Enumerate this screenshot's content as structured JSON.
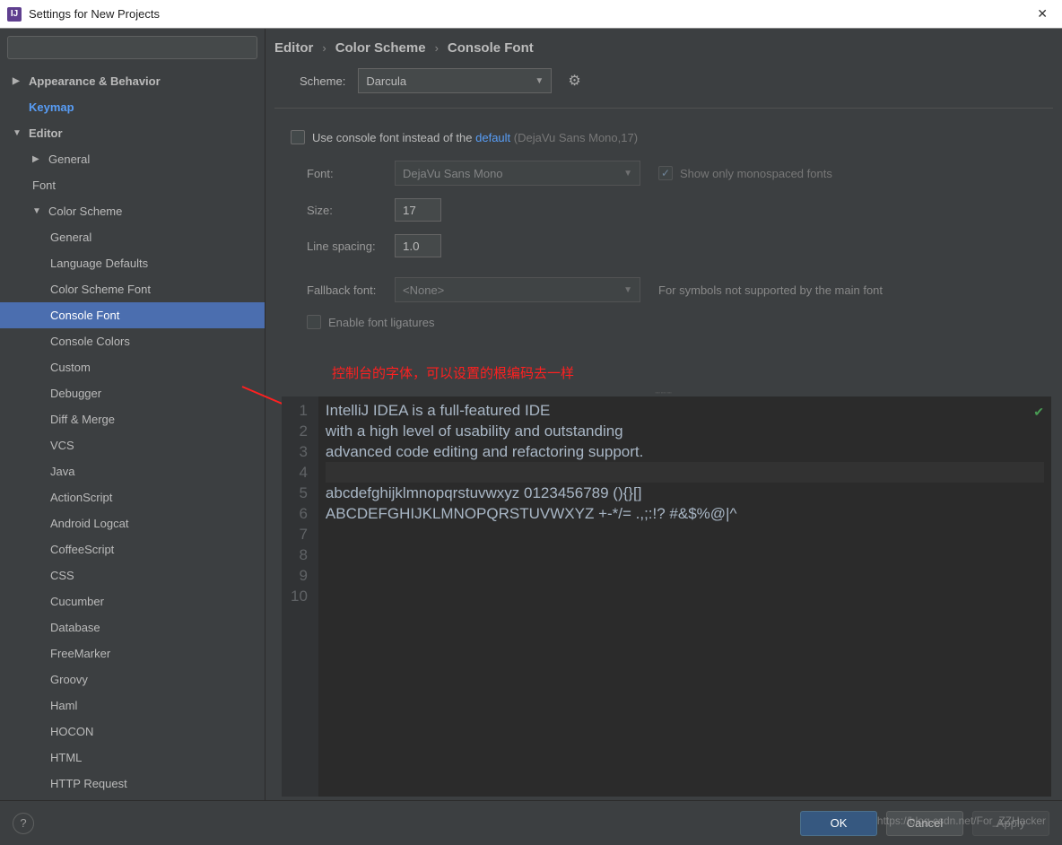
{
  "window": {
    "title": "Settings for New Projects"
  },
  "search": {
    "placeholder": ""
  },
  "tree": [
    {
      "label": "Appearance & Behavior",
      "level": 0,
      "bold": true,
      "arrow": "▶"
    },
    {
      "label": "Keymap",
      "level": 0,
      "bold": true,
      "active": true
    },
    {
      "label": "Editor",
      "level": 0,
      "bold": true,
      "arrow": "▼"
    },
    {
      "label": "General",
      "level": 1,
      "arrow": "▶"
    },
    {
      "label": "Font",
      "level": 1
    },
    {
      "label": "Color Scheme",
      "level": 1,
      "arrow": "▼"
    },
    {
      "label": "General",
      "level": 2
    },
    {
      "label": "Language Defaults",
      "level": 2
    },
    {
      "label": "Color Scheme Font",
      "level": 2
    },
    {
      "label": "Console Font",
      "level": 2,
      "selected": true
    },
    {
      "label": "Console Colors",
      "level": 2
    },
    {
      "label": "Custom",
      "level": 2
    },
    {
      "label": "Debugger",
      "level": 2
    },
    {
      "label": "Diff & Merge",
      "level": 2
    },
    {
      "label": "VCS",
      "level": 2
    },
    {
      "label": "Java",
      "level": 2
    },
    {
      "label": "ActionScript",
      "level": 2
    },
    {
      "label": "Android Logcat",
      "level": 2
    },
    {
      "label": "CoffeeScript",
      "level": 2
    },
    {
      "label": "CSS",
      "level": 2
    },
    {
      "label": "Cucumber",
      "level": 2
    },
    {
      "label": "Database",
      "level": 2
    },
    {
      "label": "FreeMarker",
      "level": 2
    },
    {
      "label": "Groovy",
      "level": 2
    },
    {
      "label": "Haml",
      "level": 2
    },
    {
      "label": "HOCON",
      "level": 2
    },
    {
      "label": "HTML",
      "level": 2
    },
    {
      "label": "HTTP Request",
      "level": 2
    }
  ],
  "breadcrumb": [
    "Editor",
    "Color Scheme",
    "Console Font"
  ],
  "scheme": {
    "label": "Scheme:",
    "value": "Darcula"
  },
  "useConsole": {
    "label": "Use console font instead of the ",
    "link": "default",
    "suffix": " (DejaVu Sans Mono,17)"
  },
  "fields": {
    "font": {
      "label": "Font:",
      "value": "DejaVu Sans Mono"
    },
    "monospaced": {
      "label": "Show only monospaced fonts"
    },
    "size": {
      "label": "Size:",
      "value": "17"
    },
    "spacing": {
      "label": "Line spacing:",
      "value": "1.0"
    },
    "fallback": {
      "label": "Fallback font:",
      "value": "<None>",
      "hint": "For symbols not supported by the main font"
    },
    "ligatures": {
      "label": "Enable font ligatures"
    }
  },
  "annotation": "控制台的字体，可以设置的根编码去一样",
  "preview": {
    "lines": [
      "IntelliJ IDEA is a full-featured IDE",
      "with a high level of usability and outstanding",
      "advanced code editing and refactoring support.",
      "",
      "abcdefghijklmnopqrstuvwxyz 0123456789 (){}[]",
      "ABCDEFGHIJKLMNOPQRSTUVWXYZ +-*/= .,;:!? #&$%@|^",
      "",
      "",
      "",
      ""
    ],
    "highlightLine": 4
  },
  "buttons": {
    "ok": "OK",
    "cancel": "Cancel",
    "apply": "Apply"
  },
  "watermark": "https://blog.csdn.net/For_ZZHacker"
}
